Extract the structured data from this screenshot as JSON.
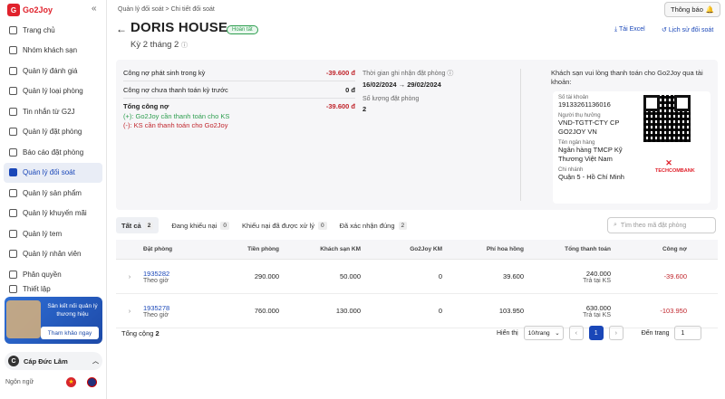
{
  "brand": {
    "name": "Go2Joy",
    "mark": "G"
  },
  "sidebar": {
    "items": [
      {
        "label": "Trang chủ",
        "icon": "home-icon"
      },
      {
        "label": "Nhóm khách sạn",
        "icon": "building-icon"
      },
      {
        "label": "Quản lý đánh giá",
        "icon": "star-icon"
      },
      {
        "label": "Quản lý loại phòng",
        "icon": "room-icon"
      },
      {
        "label": "Tin nhắn từ G2J",
        "icon": "message-icon"
      },
      {
        "label": "Quản lý đặt phòng",
        "icon": "calendar-icon"
      },
      {
        "label": "Báo cáo đặt phòng",
        "icon": "chart-icon"
      },
      {
        "label": "Quản lý đối soát",
        "icon": "document-icon",
        "active": true
      },
      {
        "label": "Quản lý sản phẩm",
        "icon": "box-icon"
      },
      {
        "label": "Quản lý khuyến mãi",
        "icon": "tag-icon"
      },
      {
        "label": "Quản lý tem",
        "icon": "stamp-icon"
      },
      {
        "label": "Quản lý nhân viên",
        "icon": "users-icon"
      },
      {
        "label": "Phân quyền",
        "icon": "shield-icon"
      },
      {
        "label": "Thiết lập",
        "icon": "gear-icon"
      }
    ],
    "promo": {
      "text": "Sản kết nối quản lý thương hiệu",
      "button": "Tham khảo ngay"
    },
    "user": {
      "initial": "C",
      "name": "Cáp Đức Lâm"
    },
    "language_label": "Ngôn ngữ"
  },
  "header": {
    "breadcrumb": [
      "Quản lý đối soát",
      "Chi tiết đối soát"
    ],
    "notification_label": "Thông báo",
    "title": "DORIS HOUSE",
    "status": "Hoàn tất",
    "period": "Kỳ 2 tháng 2",
    "export_label": "Tải Excel",
    "history_label": "Lịch sử đối soát"
  },
  "summary": {
    "incurred_label": "Công nợ phát sinh trong kỳ",
    "incurred_value": "-39.600 đ",
    "unpaid_prev_label": "Công nợ chưa thanh toán kỳ trước",
    "unpaid_prev_value": "0 đ",
    "total_label": "Tổng công nợ",
    "total_value": "-39.600 đ",
    "note_plus": "(+): Go2Joy cần thanh toán cho KS",
    "note_minus": "(-): KS cần thanh toán cho Go2Joy",
    "time_label": "Thời gian ghi nhận đặt phòng",
    "time_value": "16/02/2024 → 29/02/2024",
    "count_label": "Số lượng đặt phòng",
    "count_value": "2"
  },
  "bank": {
    "intro": "Khách sạn vui lòng thanh toán cho Go2Joy qua tài khoản:",
    "account_label": "Số tài khoản",
    "account_value": "19133261136016",
    "holder_label": "Người thụ hưởng",
    "holder_value": "VND-TGTT-CTY CP GO2JOY VN",
    "bank_label": "Tên ngân hàng",
    "bank_value": "Ngân hàng TMCP Kỹ Thương Việt Nam",
    "branch_label": "Chi nhánh",
    "branch_value": "Quận 5 - Hồ Chí Minh",
    "logo_text": "TECHCOMBANK"
  },
  "tabs": [
    {
      "label": "Tất cả",
      "count": "2",
      "active": true
    },
    {
      "label": "Đang khiếu nại",
      "count": "0"
    },
    {
      "label": "Khiếu nại đã được xử lý",
      "count": "0"
    },
    {
      "label": "Đã xác nhận đúng",
      "count": "2"
    }
  ],
  "search": {
    "placeholder": "Tìm theo mã đặt phòng"
  },
  "table": {
    "headers": [
      "Đặt phòng",
      "Tiền phòng",
      "Khách sạn KM",
      "Go2Joy KM",
      "Phí hoa hồng",
      "Tổng thanh toán",
      "Công nợ"
    ],
    "rows": [
      {
        "id": "1935282",
        "type": "Theo giờ",
        "room": "290.000",
        "hotel_km": "50.000",
        "g2j_km": "0",
        "fee": "39.600",
        "total": "240.000",
        "total_note": "Trả tại KS",
        "debt": "-39.600"
      },
      {
        "id": "1935278",
        "type": "Theo giờ",
        "room": "760.000",
        "hotel_km": "130.000",
        "g2j_km": "0",
        "fee": "103.950",
        "total": "630.000",
        "total_note": "Trả tại KS",
        "debt": "-103.950"
      }
    ],
    "total_label": "Tổng cộng",
    "total_count": "2"
  },
  "pagination": {
    "show_label": "Hiển thị",
    "page_size": "10/trang",
    "current": "1",
    "jump_label": "Đến trang",
    "jump_value": "1"
  }
}
